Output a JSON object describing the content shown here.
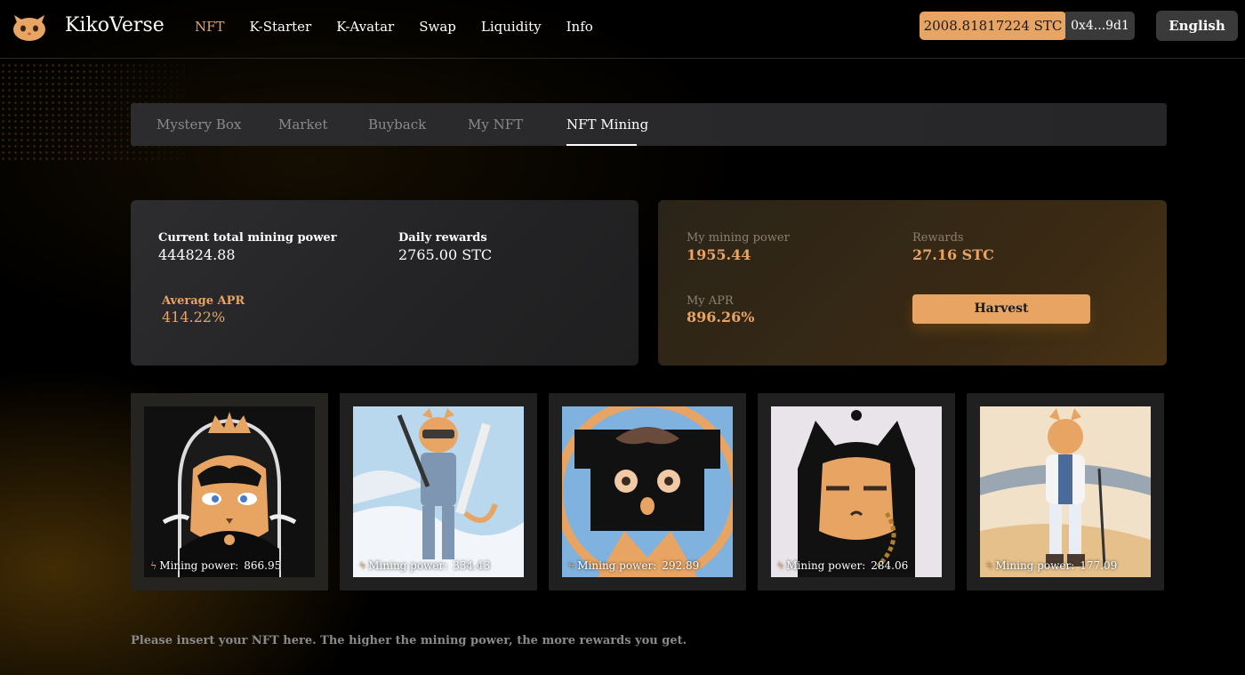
{
  "header": {
    "logo_text": "KikoVerse",
    "nav": [
      "NFT",
      "K-Starter",
      "K-Avatar",
      "Swap",
      "Liquidity",
      "Info"
    ],
    "active_nav": "NFT",
    "balance": "2008.81817224  STC",
    "address": "0x4...9d1",
    "language": "English",
    "accent_color": "#e8a462"
  },
  "tabs": {
    "items": [
      "Mystery Box",
      "Market",
      "Buyback",
      "My NFT",
      "NFT Mining"
    ],
    "active": "NFT Mining"
  },
  "pool": {
    "total_power_label": "Current total mining power",
    "total_power_value": "444824.88",
    "daily_rewards_label": "Daily rewards",
    "daily_rewards_value": "2765.00 STC",
    "apr_label": "Average APR",
    "apr_value": "414.22%"
  },
  "mine": {
    "power_label": "My mining power",
    "power_value": "1955.44",
    "rewards_label": "Rewards",
    "rewards_value": "27.16 STC",
    "apr_label": "My APR",
    "apr_value": "896.26%",
    "harvest_label": "Harvest"
  },
  "nfts": [
    {
      "power_label": "Mining power:",
      "power": "866.95",
      "icon": "queen-cat"
    },
    {
      "power_label": "Mining power:",
      "power": "334.43",
      "icon": "ski-cat"
    },
    {
      "power_label": "Mining power:",
      "power": "292.89",
      "icon": "flower-eye-cat"
    },
    {
      "power_label": "Mining power:",
      "power": "284.06",
      "icon": "hooded-cat"
    },
    {
      "power_label": "Mining power:",
      "power": "177.09",
      "icon": "hiker-cat"
    }
  ],
  "footer_note": "Please insert your NFT here. The higher the mining power, the more rewards you get."
}
